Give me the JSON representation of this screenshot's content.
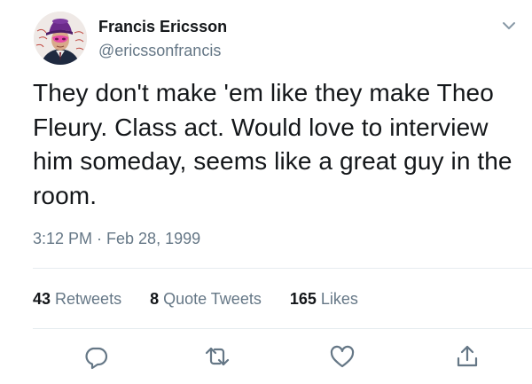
{
  "user": {
    "display_name": "Francis Ericsson",
    "handle": "@ericssonfrancis"
  },
  "tweet": {
    "text": "They don't make 'em like they make Theo Fleury. Class act. Would love to interview him someday, seems like a great guy in the room.",
    "timestamp": "3:12 PM · Feb 28, 1999"
  },
  "stats": {
    "retweets_count": "43",
    "retweets_label": "Retweets",
    "quote_count": "8",
    "quote_label": "Quote Tweets",
    "likes_count": "165",
    "likes_label": "Likes"
  },
  "icons": {
    "menu": "chevron-down-icon",
    "reply": "reply-icon",
    "retweet": "retweet-icon",
    "like": "heart-icon",
    "share": "share-icon"
  },
  "colors": {
    "text": "#14171a",
    "secondary_text": "#657786",
    "divider": "#e6ecf0",
    "icon": "#657786"
  }
}
